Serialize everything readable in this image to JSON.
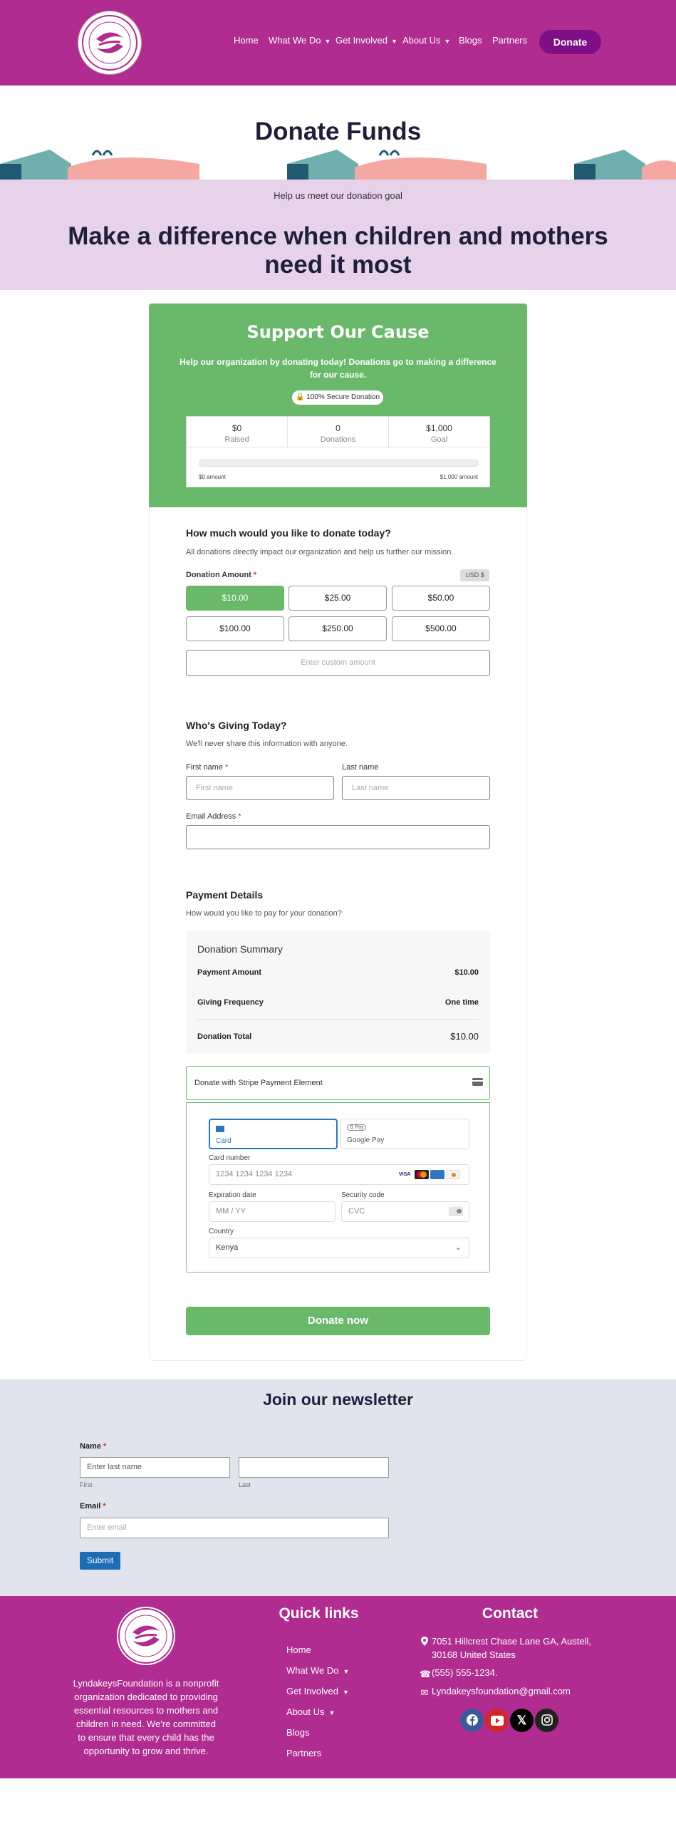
{
  "header": {
    "logo_text": "LyndakeysFoundation",
    "nav": [
      {
        "label": "Home",
        "dropdown": false
      },
      {
        "label": "What We Do",
        "dropdown": true
      },
      {
        "label": "Get Involved",
        "dropdown": true
      },
      {
        "label": "About Us",
        "dropdown": true
      },
      {
        "label": "Blogs",
        "dropdown": false
      },
      {
        "label": "Partners",
        "dropdown": false
      }
    ],
    "donate_label": "Donate"
  },
  "hero": {
    "title": "Donate Funds",
    "subtitle": "Help us meet our donation goal",
    "headline": "Make a difference when children and mothers need it most"
  },
  "cause": {
    "title": "Support Our Cause",
    "description": "Help our organization by donating today! Donations go to making a difference for our cause.",
    "secure_label": "100% Secure Donation",
    "stats": [
      {
        "value": "$0",
        "label": "Raised"
      },
      {
        "value": "0",
        "label": "Donations"
      },
      {
        "value": "$1,000",
        "label": "Goal"
      }
    ],
    "progress_fraction": 0.0,
    "bar_min_label": "$0 amount",
    "bar_max_label": "$1,000 amount"
  },
  "amount": {
    "title": "How much would you like to donate today?",
    "description": "All donations directly impact our organization and help us further our mission.",
    "label": "Donation Amount",
    "currency": "USD $",
    "options": [
      "$10.00",
      "$25.00",
      "$50.00",
      "$100.00",
      "$250.00",
      "$500.00"
    ],
    "selected_index": 0,
    "custom_placeholder": "Enter custom amount"
  },
  "giver": {
    "title": "Who's Giving Today?",
    "description": "We'll never share this information with anyone.",
    "first_label": "First name",
    "first_placeholder": "First name",
    "last_label": "Last name",
    "last_placeholder": "Last name",
    "email_label": "Email Address"
  },
  "payment": {
    "title": "Payment Details",
    "description": "How would you like to pay for your donation?",
    "summary_title": "Donation Summary",
    "rows": [
      {
        "label": "Payment Amount",
        "value": "$10.00"
      },
      {
        "label": "Giving Frequency",
        "value": "One time"
      }
    ],
    "total_label": "Donation Total",
    "total_value": "$10.00",
    "stripe_label": "Donate with Stripe Payment Element",
    "tab_card": "Card",
    "tab_gpay": "Google Pay",
    "gpay_badge": "G Pay",
    "card_number_label": "Card number",
    "card_number_placeholder": "1234 1234 1234 1234",
    "card_brands": [
      "VISA",
      "MC",
      "AMEX",
      "DISC"
    ],
    "expiry_label": "Expiration date",
    "expiry_placeholder": "MM / YY",
    "cvc_label": "Security code",
    "cvc_placeholder": "CVC",
    "country_label": "Country",
    "country_value": "Kenya",
    "submit_label": "Donate now"
  },
  "newsletter": {
    "title": "Join our newsletter",
    "name_label": "Name",
    "first_placeholder": "Enter last name",
    "first_sub": "First",
    "last_sub": "Last",
    "email_label": "Email",
    "email_placeholder": "Enter email",
    "submit_label": "Submit"
  },
  "footer": {
    "about": "LyndakeysFoundation is a nonprofit organization dedicated to providing essential resources to mothers and children in need. We're committed to ensure that every child has the opportunity to grow and thrive.",
    "links_title": "Quick links",
    "links": [
      {
        "label": "Home",
        "dropdown": false
      },
      {
        "label": "What We Do",
        "dropdown": true
      },
      {
        "label": "Get Involved",
        "dropdown": true
      },
      {
        "label": "About Us",
        "dropdown": true
      },
      {
        "label": "Blogs",
        "dropdown": false
      },
      {
        "label": "Partners",
        "dropdown": false
      }
    ],
    "contact_title": "Contact",
    "address": "7051 Hillcrest Chase Lane GA, Austell, 30168 United States",
    "phone": "(555) 555-1234.",
    "email": "Lyndakeysfoundation@gmail.com",
    "social": [
      "facebook-icon",
      "youtube-icon",
      "x-icon",
      "instagram-icon"
    ]
  },
  "colors": {
    "brand_magenta": "#b02c91",
    "donate_purple": "#7e0f86",
    "accent_green": "#6ab96b",
    "hero_band": "#e6d3ea",
    "newsletter_bg": "#e1e4ec",
    "submit_blue": "#1c6db3"
  }
}
